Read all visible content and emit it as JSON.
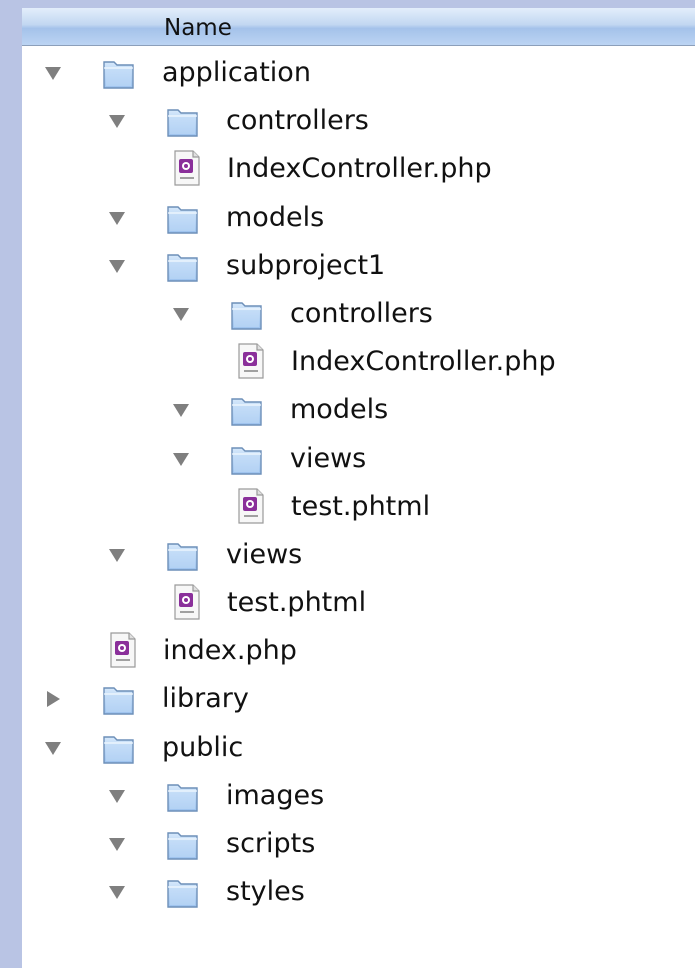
{
  "header": {
    "name_column": "Name"
  },
  "colors": {
    "background": "#b9c4e4",
    "header_top": "#e3eefb",
    "header_bottom": "#a4c2ea",
    "folder_blue": "#9cc2ee",
    "file_purple": "#8a2f9a",
    "disclosure": "#7f7f7f"
  },
  "tree": {
    "rows": [
      {
        "label": "application",
        "kind": "folder",
        "depth": 0,
        "state": "expanded"
      },
      {
        "label": "controllers",
        "kind": "folder",
        "depth": 1,
        "state": "expanded"
      },
      {
        "label": "IndexController.php",
        "kind": "file",
        "depth": 2,
        "state": "none"
      },
      {
        "label": "models",
        "kind": "folder",
        "depth": 1,
        "state": "expanded"
      },
      {
        "label": "subproject1",
        "kind": "folder",
        "depth": 1,
        "state": "expanded"
      },
      {
        "label": "controllers",
        "kind": "folder",
        "depth": 2,
        "state": "expanded"
      },
      {
        "label": "IndexController.php",
        "kind": "file",
        "depth": 3,
        "state": "none"
      },
      {
        "label": "models",
        "kind": "folder",
        "depth": 2,
        "state": "expanded"
      },
      {
        "label": "views",
        "kind": "folder",
        "depth": 2,
        "state": "expanded"
      },
      {
        "label": "test.phtml",
        "kind": "file",
        "depth": 3,
        "state": "none"
      },
      {
        "label": "views",
        "kind": "folder",
        "depth": 1,
        "state": "expanded"
      },
      {
        "label": "test.phtml",
        "kind": "file",
        "depth": 2,
        "state": "none"
      },
      {
        "label": "index.php",
        "kind": "file",
        "depth": 1,
        "state": "none"
      },
      {
        "label": "library",
        "kind": "folder",
        "depth": 0,
        "state": "collapsed"
      },
      {
        "label": "public",
        "kind": "folder",
        "depth": 0,
        "state": "expanded"
      },
      {
        "label": "images",
        "kind": "folder",
        "depth": 1,
        "state": "expanded"
      },
      {
        "label": "scripts",
        "kind": "folder",
        "depth": 1,
        "state": "expanded"
      },
      {
        "label": "styles",
        "kind": "folder",
        "depth": 1,
        "state": "expanded"
      }
    ]
  }
}
